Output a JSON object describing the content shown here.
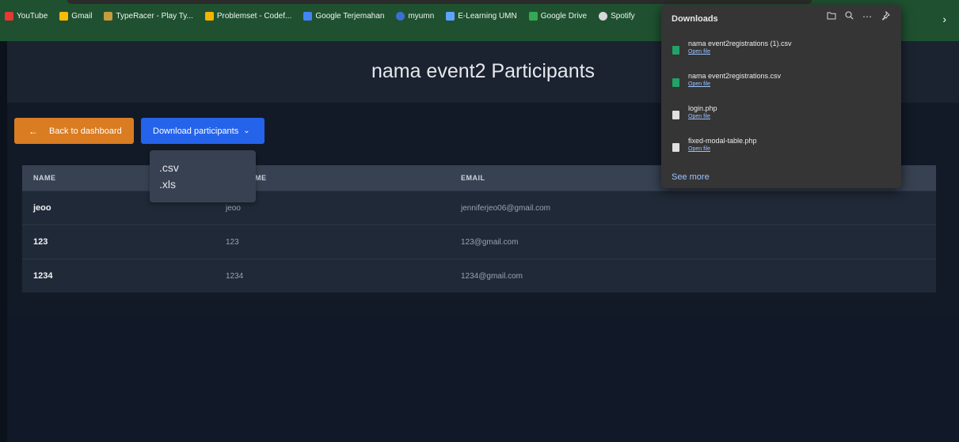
{
  "bookmarks": [
    {
      "label": "YouTube",
      "icon": "youtube-icon",
      "color": "#e53935"
    },
    {
      "label": "Gmail",
      "icon": "gmail-icon",
      "color": "#fbbc04"
    },
    {
      "label": "TypeRacer - Play Ty...",
      "icon": "typeracer-icon",
      "color": "#c69c3d"
    },
    {
      "label": "Problemset - Codef...",
      "icon": "codeforces-icon",
      "color": "#f4b400"
    },
    {
      "label": "Google Terjemahan",
      "icon": "translate-icon",
      "color": "#4285f4"
    },
    {
      "label": "myumn",
      "icon": "myumn-icon",
      "color": "#3b6fd6"
    },
    {
      "label": "E-Learning UMN",
      "icon": "elearning-icon",
      "color": "#5ea4ff"
    },
    {
      "label": "Google Drive",
      "icon": "drive-icon",
      "color": "#34a853"
    },
    {
      "label": "Spotify",
      "icon": "spotify-icon",
      "color": "#d8d8d8"
    }
  ],
  "header": {
    "title": "nama event2 Participants"
  },
  "buttons": {
    "back_label": "Back to dashboard",
    "download_label": "Download participants"
  },
  "dropdown": {
    "options": [
      ".csv",
      ".xls"
    ]
  },
  "table": {
    "headers": [
      "NAME",
      "ME",
      "EMAIL"
    ],
    "rows": [
      [
        "jeoo",
        "jeoo",
        "jenniferjeo06@gmail.com"
      ],
      [
        "123",
        "123",
        "123@gmail.com"
      ],
      [
        "1234",
        "1234",
        "1234@gmail.com"
      ]
    ]
  },
  "downloads": {
    "title": "Downloads",
    "items": [
      {
        "name": "nama event2registrations (1).csv",
        "action": "Open file",
        "type": "csv",
        "color": "#21a366"
      },
      {
        "name": "nama event2registrations.csv",
        "action": "Open file",
        "type": "csv",
        "color": "#21a366"
      },
      {
        "name": "login.php",
        "action": "Open file",
        "type": "php",
        "color": "#e0e0e0"
      },
      {
        "name": "fixed-modal-table.php",
        "action": "Open file",
        "type": "php",
        "color": "#e0e0e0"
      }
    ],
    "see_more": "See more"
  },
  "colors": {
    "accent_orange": "#d97c22",
    "accent_blue": "#2563eb",
    "bookmarks_bg": "#1f5130"
  }
}
